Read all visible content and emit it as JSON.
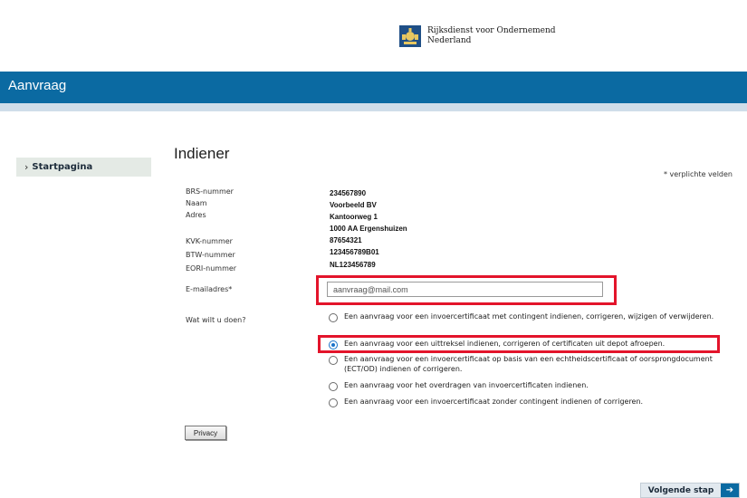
{
  "header": {
    "logo_line1": "Rijksdienst voor Ondernemend",
    "logo_line2": "Nederland",
    "banner_title": "Aanvraag"
  },
  "sidebar": {
    "items": [
      {
        "label": "Startpagina",
        "icon": "chevron-right-icon"
      }
    ]
  },
  "main": {
    "title": "Indiener",
    "required_note": "* verplichte velden",
    "fields": {
      "brs_label": "BRS-nummer",
      "brs_value": "234567890",
      "naam_label": "Naam",
      "naam_value": "Voorbeeld BV",
      "adres_label": "Adres",
      "adres_line1": "Kantoorweg 1",
      "adres_line2": "1000 AA Ergenshuizen",
      "kvk_label": "KVK-nummer",
      "kvk_value": "87654321",
      "btw_label": "BTW-nummer",
      "btw_value": "123456789B01",
      "eori_label": "EORI-nummer",
      "eori_value": "NL123456789"
    },
    "email": {
      "label": "E-mailadres*",
      "value": "aanvraag@mail.com"
    },
    "question": {
      "label": "Wat wilt u doen?",
      "options": [
        {
          "label": "Een aanvraag voor een invoercertificaat met contingent indienen, corrigeren, wijzigen of verwijderen.",
          "selected": false
        },
        {
          "label": "Een aanvraag voor een uittreksel indienen, corrigeren of certificaten uit depot afroepen.",
          "selected": true
        },
        {
          "label": "Een aanvraag voor een invoercertificaat op basis van een echtheidscertificaat of oorsprongdocument (ECT/OD) indienen of corrigeren.",
          "selected": false
        },
        {
          "label": "Een aanvraag voor het overdragen van invoercertificaten indienen.",
          "selected": false
        },
        {
          "label": "Een aanvraag voor een invoercertificaat zonder contingent indienen of corrigeren.",
          "selected": false
        }
      ]
    },
    "privacy_button": "Privacy",
    "next_button": "Volgende stap",
    "next_icon": "arrow-right-icon"
  },
  "colors": {
    "banner": "#0b6aa2",
    "highlight": "#e3142b",
    "radio_selected": "#1a73c9"
  }
}
